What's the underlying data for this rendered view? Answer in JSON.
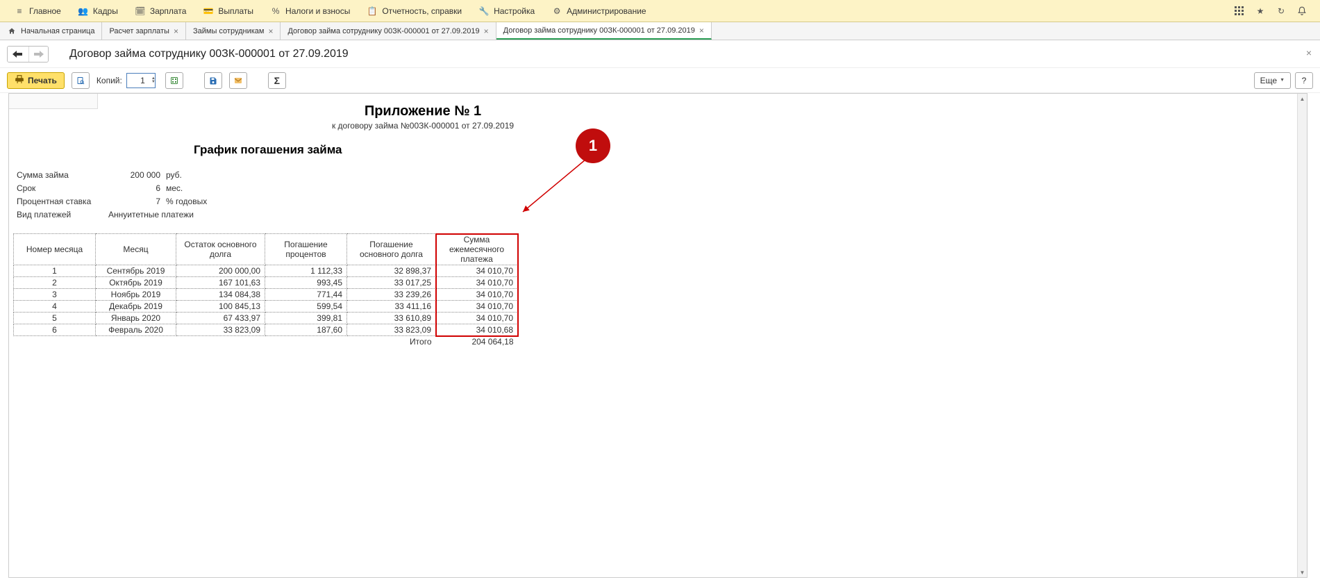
{
  "menu": {
    "items": [
      {
        "label": "Главное",
        "icon": "≡"
      },
      {
        "label": "Кадры",
        "icon": "👥"
      },
      {
        "label": "Зарплата",
        "icon": "🗓"
      },
      {
        "label": "Выплаты",
        "icon": "💳"
      },
      {
        "label": "Налоги и взносы",
        "icon": "%"
      },
      {
        "label": "Отчетность, справки",
        "icon": "📋"
      },
      {
        "label": "Настройка",
        "icon": "🔧"
      },
      {
        "label": "Администрирование",
        "icon": "⚙"
      }
    ]
  },
  "tabs": [
    {
      "label": "Начальная страница",
      "closable": false,
      "home": true
    },
    {
      "label": "Расчет зарплаты",
      "closable": true
    },
    {
      "label": "Займы сотрудникам",
      "closable": true
    },
    {
      "label": "Договор займа сотруднику 00ЗК-000001 от 27.09.2019",
      "closable": true
    },
    {
      "label": "Договор займа сотруднику 00ЗК-000001 от 27.09.2019",
      "closable": true,
      "active": true
    }
  ],
  "header": {
    "title": "Договор займа сотруднику 00ЗК-000001 от 27.09.2019"
  },
  "toolbar": {
    "print_label": "Печать",
    "copies_label": "Копий:",
    "copies_value": "1",
    "more_label": "Еще",
    "help_label": "?"
  },
  "doc": {
    "top_title": "Приложение № 1",
    "top_sub": "к договору займа №00ЗК-000001 от 27.09.2019",
    "section_title": "График погашения займа",
    "summary": {
      "amount_label": "Сумма займа",
      "amount_value": "200 000",
      "amount_unit": "руб.",
      "term_label": "Срок",
      "term_value": "6",
      "term_unit": "мес.",
      "rate_label": "Процентная ставка",
      "rate_value": "7",
      "rate_unit": "% годовых",
      "type_label": "Вид платежей",
      "type_value": "Аннуитетные платежи"
    },
    "columns": [
      "Номер месяца",
      "Месяц",
      "Остаток основного долга",
      "Погашение процентов",
      "Погашение основного долга",
      "Сумма ежемесячного платежа"
    ],
    "rows": [
      {
        "n": "1",
        "m": "Сентябрь 2019",
        "bal": "200 000,00",
        "int": "1 112,33",
        "princ": "32 898,37",
        "pay": "34 010,70"
      },
      {
        "n": "2",
        "m": "Октябрь 2019",
        "bal": "167 101,63",
        "int": "993,45",
        "princ": "33 017,25",
        "pay": "34 010,70"
      },
      {
        "n": "3",
        "m": "Ноябрь 2019",
        "bal": "134 084,38",
        "int": "771,44",
        "princ": "33 239,26",
        "pay": "34 010,70"
      },
      {
        "n": "4",
        "m": "Декабрь 2019",
        "bal": "100 845,13",
        "int": "599,54",
        "princ": "33 411,16",
        "pay": "34 010,70"
      },
      {
        "n": "5",
        "m": "Январь 2020",
        "bal": "67 433,97",
        "int": "399,81",
        "princ": "33 610,89",
        "pay": "34 010,70"
      },
      {
        "n": "6",
        "m": "Февраль 2020",
        "bal": "33 823,09",
        "int": "187,60",
        "princ": "33 823,09",
        "pay": "34 010,68"
      }
    ],
    "totals_label": "Итого",
    "totals_value": "204 064,18"
  },
  "callout": {
    "number": "1"
  }
}
